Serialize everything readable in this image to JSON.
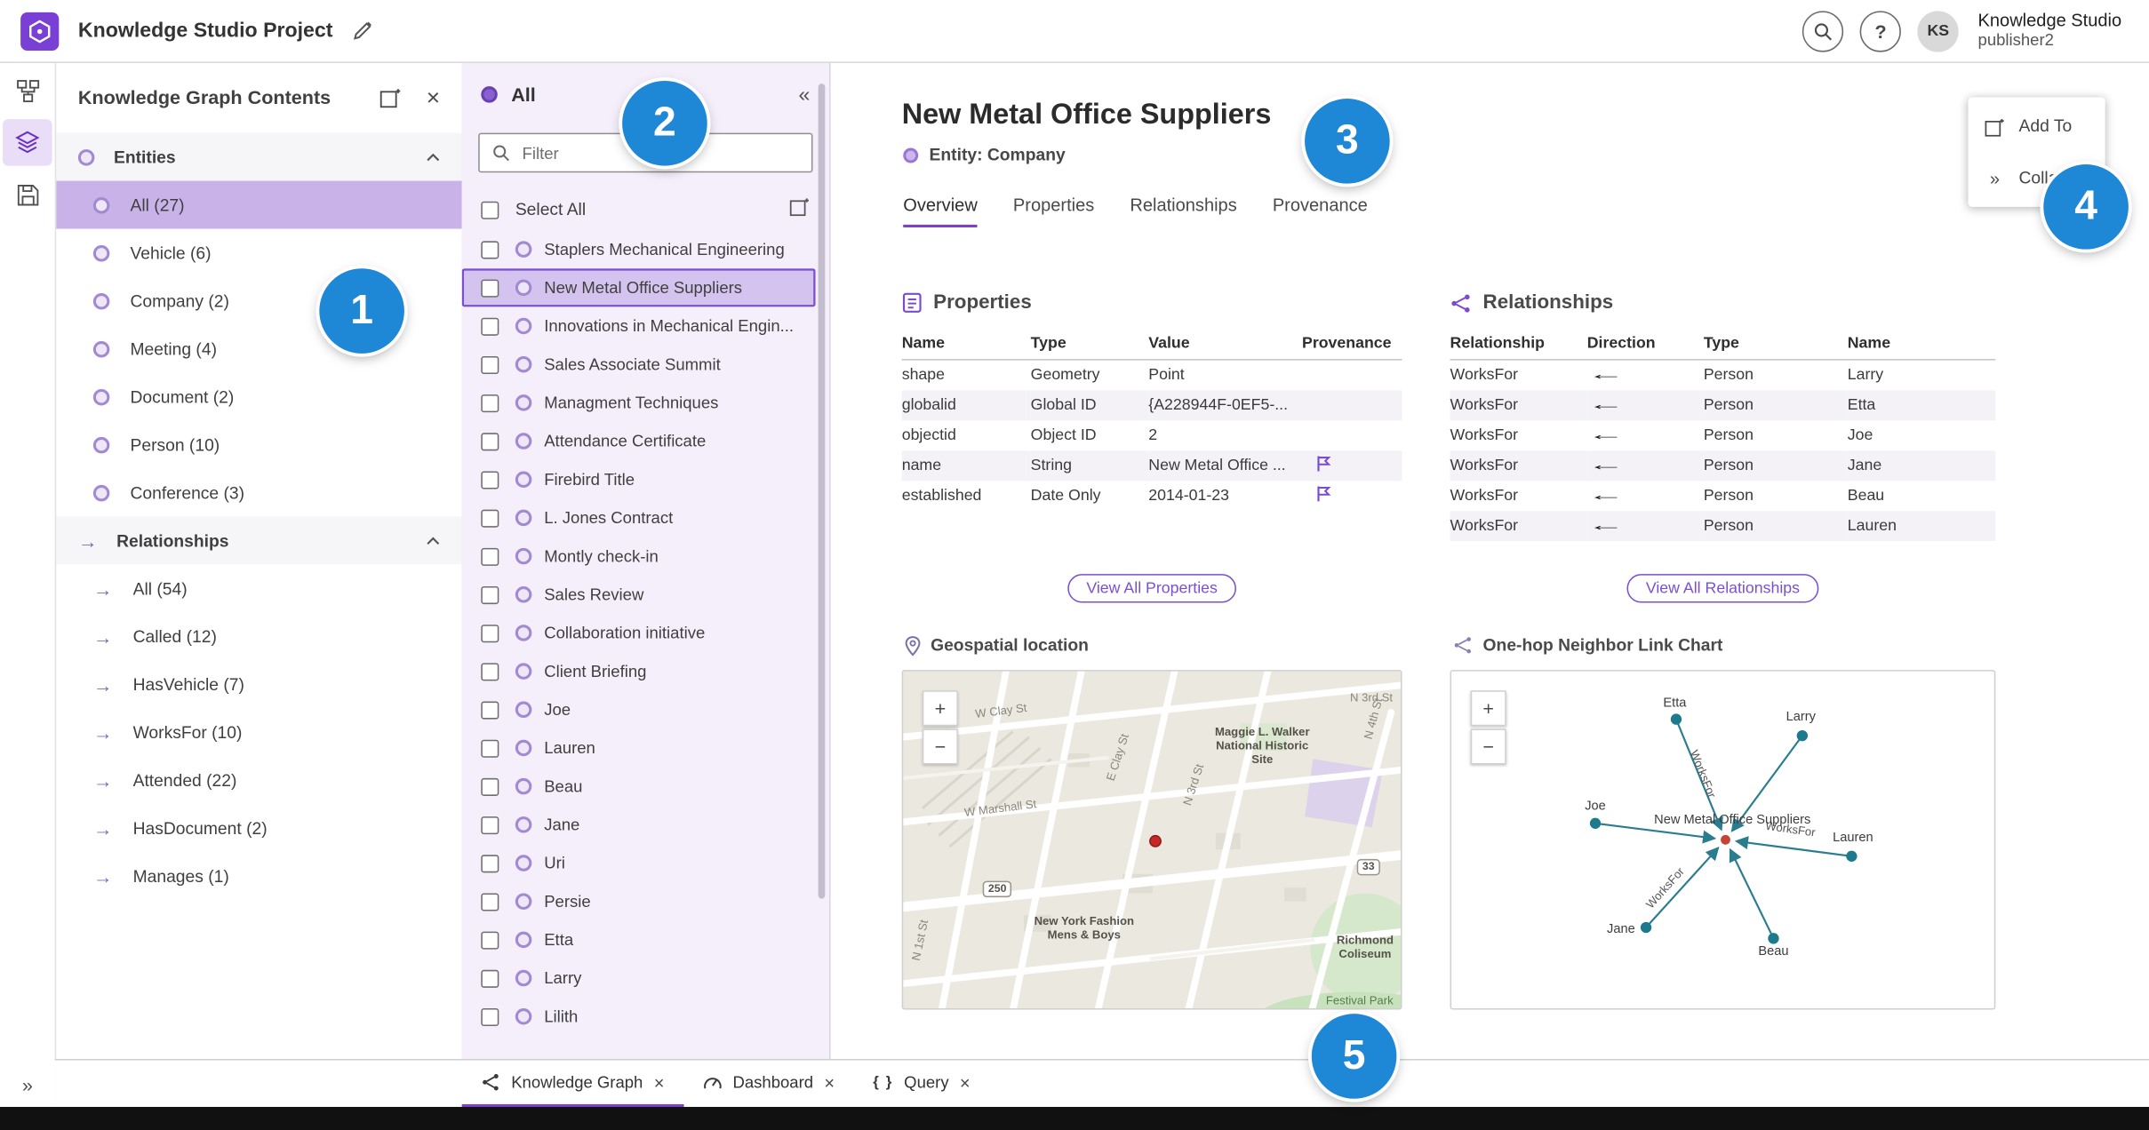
{
  "app": {
    "title": "Knowledge Studio Project",
    "user": {
      "initials": "KS",
      "org": "Knowledge Studio",
      "name": "publisher2"
    }
  },
  "ui": {
    "close": "×",
    "collapse_panel": "«",
    "expand_rail": "»",
    "rel_arrow": "→",
    "zoom_in": "+",
    "zoom_out": "−",
    "query_glyph": "{ }"
  },
  "colors": {
    "accent_purple": "#7a4bd0",
    "selection_purple": "#c9b2e8",
    "link_purple": "#6152d6",
    "annotation_blue": "#1e87d6",
    "chart_teal": "#1d7a8c",
    "map_point_red": "#c62828"
  },
  "contents_panel": {
    "title": "Knowledge Graph Contents",
    "entities": {
      "label": "Entities",
      "selected_index": 0,
      "items": [
        "All (27)",
        "Vehicle (6)",
        "Company (2)",
        "Meeting (4)",
        "Document (2)",
        "Person (10)",
        "Conference (3)"
      ]
    },
    "relationships": {
      "label": "Relationships",
      "selected_index": -1,
      "items": [
        "All (54)",
        "Called (12)",
        "HasVehicle (7)",
        "WorksFor (10)",
        "Attended (22)",
        "HasDocument (2)",
        "Manages (1)"
      ]
    }
  },
  "list_panel": {
    "title": "All",
    "filter_placeholder": "Filter",
    "select_all_label": "Select All",
    "selected_index": 1,
    "items": [
      "Staplers Mechanical Engineering",
      "New Metal Office Suppliers",
      "Innovations in Mechanical Engin...",
      "Sales Associate Summit",
      "Managment Techniques",
      "Attendance Certificate",
      "Firebird Title",
      "L. Jones Contract",
      "Montly check-in",
      "Sales Review",
      "Collaboration initiative",
      "Client Briefing",
      "Joe",
      "Lauren",
      "Beau",
      "Jane",
      "Uri",
      "Persie",
      "Etta",
      "Larry",
      "Lilith"
    ]
  },
  "detail": {
    "title": "New Metal Office Suppliers",
    "entity_type": "Entity: Company",
    "tabs": [
      "Overview",
      "Properties",
      "Relationships",
      "Provenance"
    ],
    "active_tab": "Overview",
    "properties": {
      "heading": "Properties",
      "columns": [
        "Name",
        "Type",
        "Value",
        "Provenance"
      ],
      "rows": [
        {
          "name": "shape",
          "type": "Geometry",
          "value": "Point",
          "has_provenance": false
        },
        {
          "name": "globalid",
          "type": "Global ID",
          "value": "{A228944F-0EF5-...",
          "has_provenance": false
        },
        {
          "name": "objectid",
          "type": "Object ID",
          "value": "2",
          "has_provenance": false
        },
        {
          "name": "name",
          "type": "String",
          "value": "New Metal Office ...",
          "has_provenance": true
        },
        {
          "name": "established",
          "type": "Date Only",
          "value": "2014-01-23",
          "has_provenance": true
        }
      ],
      "view_all_label": "View All Properties"
    },
    "relationships": {
      "heading": "Relationships",
      "columns": [
        "Relationship",
        "Direction",
        "Type",
        "Name"
      ],
      "rows": [
        {
          "relationship": "WorksFor",
          "direction": "←",
          "type": "Person",
          "name": "Larry"
        },
        {
          "relationship": "WorksFor",
          "direction": "←",
          "type": "Person",
          "name": "Etta"
        },
        {
          "relationship": "WorksFor",
          "direction": "←",
          "type": "Person",
          "name": "Joe"
        },
        {
          "relationship": "WorksFor",
          "direction": "←",
          "type": "Person",
          "name": "Jane"
        },
        {
          "relationship": "WorksFor",
          "direction": "←",
          "type": "Person",
          "name": "Beau"
        },
        {
          "relationship": "WorksFor",
          "direction": "←",
          "type": "Person",
          "name": "Lauren"
        }
      ],
      "view_all_label": "View All Relationships"
    },
    "map": {
      "heading": "Geospatial location",
      "street_labels": [
        "W Clay St",
        "E Clay St",
        "N 3rd St",
        "N 4th St",
        "N 3rd St",
        "W Marshall St",
        "N 1st St"
      ],
      "place_labels": [
        "Maggie L. Walker National Historic Site",
        "New York Fashion Mens & Boys",
        "Richmond Coliseum",
        "Festival Park"
      ],
      "route_shields": [
        "250",
        "33"
      ]
    },
    "link_chart": {
      "heading": "One-hop Neighbor Link Chart",
      "center_label": "New Metal Office Suppliers",
      "nodes": [
        "Etta",
        "Larry",
        "Joe",
        "Lauren",
        "Jane",
        "Beau"
      ],
      "edge_label": "WorksFor"
    }
  },
  "overlay_menu": {
    "items": [
      "Add To",
      "Colla"
    ]
  },
  "bottom_bar": {
    "active_index": 0,
    "tabs": [
      {
        "label": "Knowledge Graph"
      },
      {
        "label": "Dashboard"
      },
      {
        "label": "Query"
      }
    ]
  },
  "annotations": {
    "numbers": [
      "1",
      "2",
      "3",
      "4",
      "5"
    ]
  }
}
